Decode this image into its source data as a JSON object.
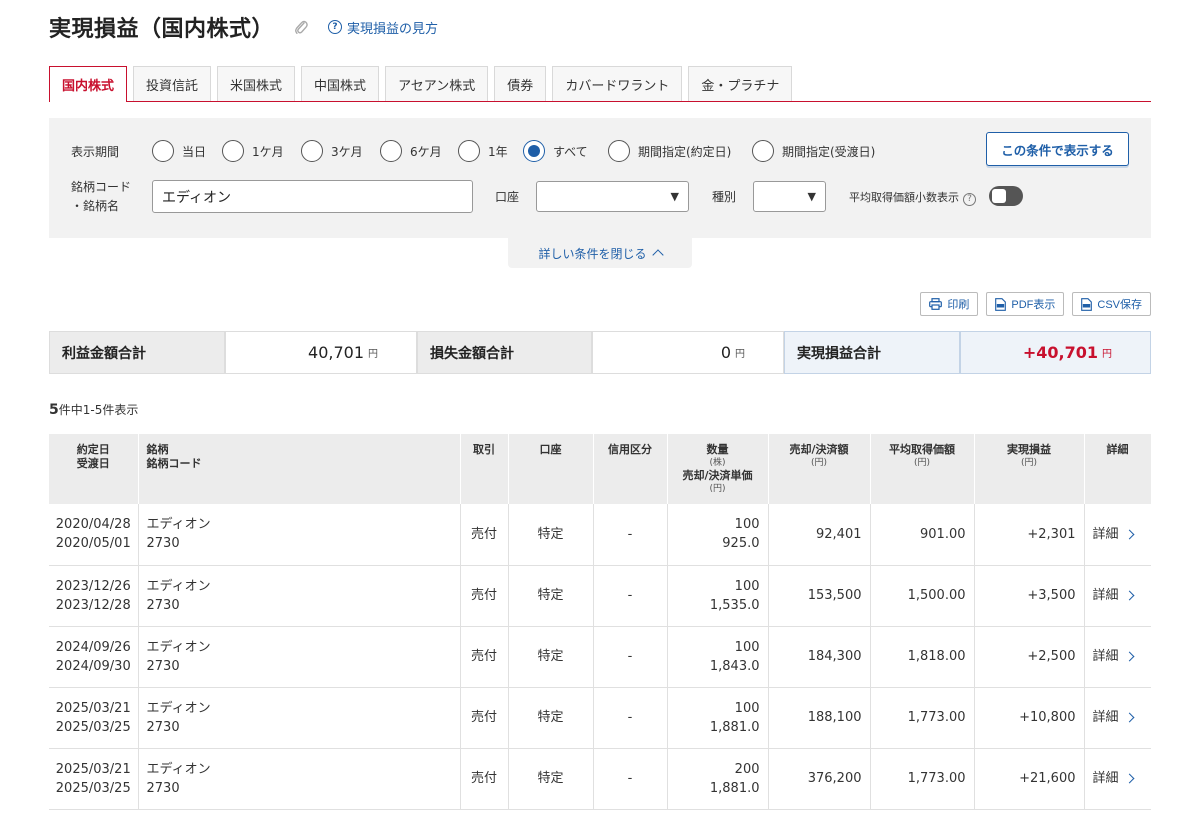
{
  "header": {
    "title": "実現損益（国内株式）",
    "help_link": "実現損益の見方"
  },
  "tabs": [
    {
      "label": "国内株式",
      "active": true
    },
    {
      "label": "投資信託",
      "active": false
    },
    {
      "label": "米国株式",
      "active": false
    },
    {
      "label": "中国株式",
      "active": false
    },
    {
      "label": "アセアン株式",
      "active": false
    },
    {
      "label": "債券",
      "active": false
    },
    {
      "label": "カバードワラント",
      "active": false
    },
    {
      "label": "金・プラチナ",
      "active": false
    }
  ],
  "filter": {
    "period_label": "表示期間",
    "periods": [
      "当日",
      "1ケ月",
      "3ケ月",
      "6ケ月",
      "1年",
      "すべて",
      "期間指定(約定日)",
      "期間指定(受渡日)"
    ],
    "selected_period": "すべて",
    "apply_button": "この条件で表示する",
    "code_label_line1": "銘柄コード",
    "code_label_line2": "・銘柄名",
    "code_value": "エディオン",
    "account_label": "口座",
    "account_value": "",
    "type_label": "種別",
    "type_value": "",
    "decimal_label": "平均取得価額小数表示",
    "decimal_on": false,
    "collapse_label": "詳しい条件を閉じる"
  },
  "actions": {
    "print": "印刷",
    "pdf": "PDF表示",
    "csv": "CSV保存"
  },
  "summary": {
    "profit_label": "利益金額合計",
    "profit_value": "40,701",
    "loss_label": "損失金額合計",
    "loss_value": "0",
    "total_label": "実現損益合計",
    "total_value": "+40,701",
    "yen": "円"
  },
  "count": {
    "total": "5",
    "text": "件中1-5件表示"
  },
  "table": {
    "headers": {
      "date1": "約定日",
      "date2": "受渡日",
      "name1": "銘柄",
      "name2": "銘柄コード",
      "trade": "取引",
      "account": "口座",
      "credit": "信用区分",
      "qty": "数量",
      "qty_unit": "(株)",
      "unit_price": "売却/決済単価",
      "unit_price_unit": "(円)",
      "amount": "売却/決済額",
      "amount_unit": "(円)",
      "avg": "平均取得価額",
      "avg_unit": "(円)",
      "pl": "実現損益",
      "pl_unit": "(円)",
      "detail": "詳細"
    },
    "rows": [
      {
        "trade_date": "2020/04/28",
        "settle_date": "2020/05/01",
        "name": "エディオン",
        "code": "2730",
        "trade": "売付",
        "account": "特定",
        "credit": "-",
        "qty": "100",
        "price": "925.0",
        "amount": "92,401",
        "avg": "901.00",
        "pl": "+2,301",
        "detail": "詳細"
      },
      {
        "trade_date": "2023/12/26",
        "settle_date": "2023/12/28",
        "name": "エディオン",
        "code": "2730",
        "trade": "売付",
        "account": "特定",
        "credit": "-",
        "qty": "100",
        "price": "1,535.0",
        "amount": "153,500",
        "avg": "1,500.00",
        "pl": "+3,500",
        "detail": "詳細"
      },
      {
        "trade_date": "2024/09/26",
        "settle_date": "2024/09/30",
        "name": "エディオン",
        "code": "2730",
        "trade": "売付",
        "account": "特定",
        "credit": "-",
        "qty": "100",
        "price": "1,843.0",
        "amount": "184,300",
        "avg": "1,818.00",
        "pl": "+2,500",
        "detail": "詳細"
      },
      {
        "trade_date": "2025/03/21",
        "settle_date": "2025/03/25",
        "name": "エディオン",
        "code": "2730",
        "trade": "売付",
        "account": "特定",
        "credit": "-",
        "qty": "100",
        "price": "1,881.0",
        "amount": "188,100",
        "avg": "1,773.00",
        "pl": "+10,800",
        "detail": "詳細"
      },
      {
        "trade_date": "2025/03/21",
        "settle_date": "2025/03/25",
        "name": "エディオン",
        "code": "2730",
        "trade": "売付",
        "account": "特定",
        "credit": "-",
        "qty": "200",
        "price": "1,881.0",
        "amount": "376,200",
        "avg": "1,773.00",
        "pl": "+21,600",
        "detail": "詳細"
      }
    ]
  },
  "colors": {
    "accent_red": "#c8102e",
    "link_blue": "#1f5fa8",
    "panel_gray": "#f2f2f2"
  }
}
